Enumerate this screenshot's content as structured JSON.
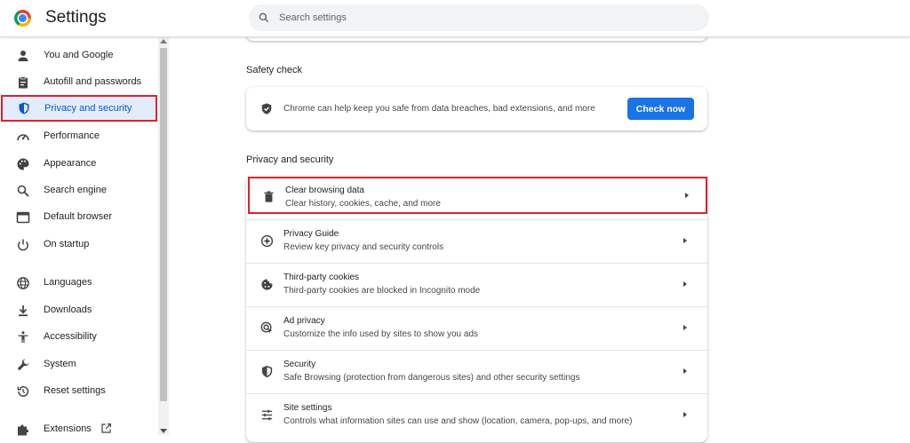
{
  "app": {
    "title": "Settings"
  },
  "search": {
    "placeholder": "Search settings"
  },
  "sidebar": {
    "items": [
      {
        "label": "You and Google",
        "icon": "person-icon"
      },
      {
        "label": "Autofill and passwords",
        "icon": "clipboard-icon"
      },
      {
        "label": "Privacy and security",
        "icon": "shield-icon",
        "active": true
      },
      {
        "label": "Performance",
        "icon": "speedometer-icon"
      },
      {
        "label": "Appearance",
        "icon": "palette-icon"
      },
      {
        "label": "Search engine",
        "icon": "search-icon"
      },
      {
        "label": "Default browser",
        "icon": "browser-icon"
      },
      {
        "label": "On startup",
        "icon": "power-icon"
      },
      {
        "label": "Languages",
        "icon": "globe-icon"
      },
      {
        "label": "Downloads",
        "icon": "download-icon"
      },
      {
        "label": "Accessibility",
        "icon": "accessibility-icon"
      },
      {
        "label": "System",
        "icon": "wrench-icon"
      },
      {
        "label": "Reset settings",
        "icon": "reset-icon"
      },
      {
        "label": "Extensions",
        "icon": "puzzle-icon",
        "external": true
      }
    ]
  },
  "safety_check": {
    "heading": "Safety check",
    "text": "Chrome can help keep you safe from data breaches, bad extensions, and more",
    "button": "Check now"
  },
  "privacy": {
    "heading": "Privacy and security",
    "rows": [
      {
        "title": "Clear browsing data",
        "subtitle": "Clear history, cookies, cache, and more",
        "icon": "trash-icon",
        "highlighted": true
      },
      {
        "title": "Privacy Guide",
        "subtitle": "Review key privacy and security controls",
        "icon": "compass-icon"
      },
      {
        "title": "Third-party cookies",
        "subtitle": "Third-party cookies are blocked in Incognito mode",
        "icon": "cookie-icon"
      },
      {
        "title": "Ad privacy",
        "subtitle": "Customize the info used by sites to show you ads",
        "icon": "ad-privacy-icon"
      },
      {
        "title": "Security",
        "subtitle": "Safe Browsing (protection from dangerous sites) and other security settings",
        "icon": "shield-icon"
      },
      {
        "title": "Site settings",
        "subtitle": "Controls what information sites can use and show (location, camera, pop-ups, and more)",
        "icon": "sliders-icon"
      }
    ]
  },
  "colors": {
    "accent": "#0b57d0",
    "button": "#1a73e8",
    "active_bg": "#e2ecfb",
    "highlight_border": "#e0202d"
  }
}
